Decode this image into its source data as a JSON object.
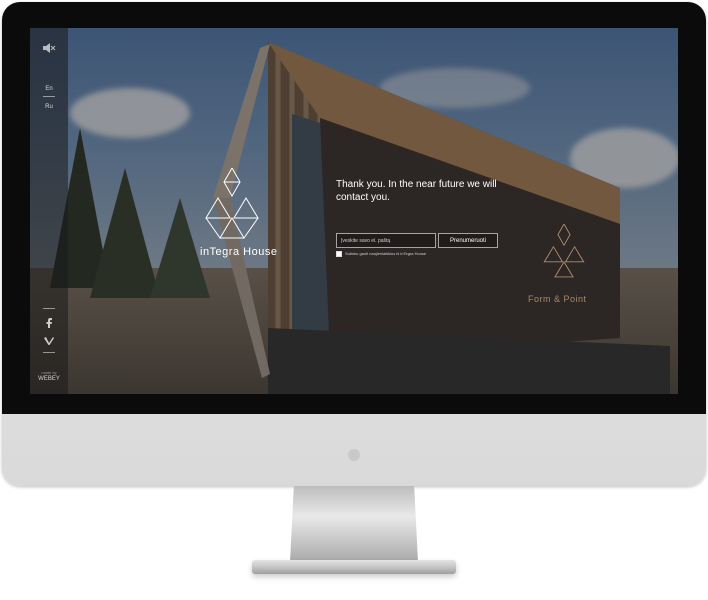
{
  "rail": {
    "lang_en": "En",
    "lang_ru": "Ru",
    "facebook_icon": "facebook-icon",
    "vimeo_icon": "vimeo-icon",
    "credit_small": "made by",
    "credit_brand": "WEBEY"
  },
  "brand": {
    "name": "inTegra House",
    "logo_icon": "triangle-diamond-logo-icon"
  },
  "form": {
    "message": "Thank you. In the near future we will contact you.",
    "email_placeholder": "Įveskite savo el. paštą",
    "subscribe_label": "Prenumeruoti",
    "consent_label": "Sutinku gauti naujienlaiškius iš inTegra House"
  },
  "sign": {
    "text": "Form & Point"
  },
  "colors": {
    "bezel": "#0b0b0b",
    "text_white": "#ffffff",
    "sign_accent": "#c8a078"
  }
}
